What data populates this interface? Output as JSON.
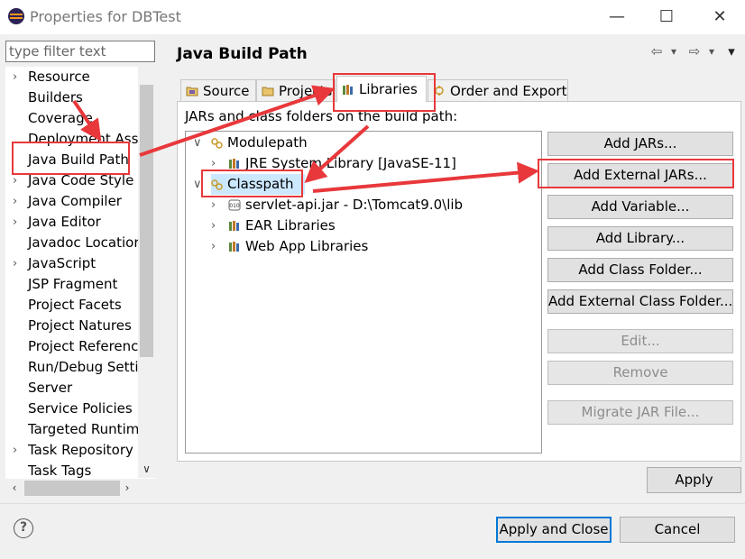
{
  "window": {
    "title": "Properties for DBTest",
    "minimize_glyph": "—",
    "maximize_glyph": "☐",
    "close_glyph": "✕"
  },
  "filter": {
    "placeholder": "type filter text"
  },
  "nav": {
    "items": [
      {
        "label": "Resource",
        "expandable": true
      },
      {
        "label": "Builders",
        "expandable": false
      },
      {
        "label": "Coverage",
        "expandable": false
      },
      {
        "label": "Deployment Ass",
        "expandable": false
      },
      {
        "label": "Java Build Path",
        "expandable": false,
        "selected": true
      },
      {
        "label": "Java Code Style",
        "expandable": true
      },
      {
        "label": "Java Compiler",
        "expandable": true
      },
      {
        "label": "Java Editor",
        "expandable": true
      },
      {
        "label": "Javadoc Locatior",
        "expandable": false
      },
      {
        "label": "JavaScript",
        "expandable": true
      },
      {
        "label": "JSP Fragment",
        "expandable": false
      },
      {
        "label": "Project Facets",
        "expandable": false
      },
      {
        "label": "Project Natures",
        "expandable": false
      },
      {
        "label": "Project Referenc",
        "expandable": false
      },
      {
        "label": "Run/Debug Setti",
        "expandable": false
      },
      {
        "label": "Server",
        "expandable": false
      },
      {
        "label": "Service Policies",
        "expandable": false
      },
      {
        "label": "Targeted Runtim",
        "expandable": false
      },
      {
        "label": "Task Repository",
        "expandable": true
      },
      {
        "label": "Task Tags",
        "expandable": false
      }
    ]
  },
  "header": {
    "title": "Java Build Path",
    "back_glyph": "⇦",
    "forward_glyph": "⇨",
    "dropdown_glyph": "▾",
    "menu_glyph": "▾"
  },
  "tabs": [
    {
      "label": "Source"
    },
    {
      "label": "Projects"
    },
    {
      "label": "Libraries",
      "active": true
    },
    {
      "label": "Order and Export"
    }
  ],
  "libraries": {
    "heading": "JARs and class folders on the build path:",
    "tree": [
      {
        "label": "Modulepath",
        "expanded": true
      },
      {
        "label": "JRE System Library [JavaSE-11]",
        "expanded": false
      },
      {
        "label": "Classpath",
        "expanded": true,
        "selected": true
      },
      {
        "label": "servlet-api.jar - D:\\Tomcat9.0\\lib",
        "expanded": false
      },
      {
        "label": "EAR Libraries",
        "expanded": false
      },
      {
        "label": "Web App Libraries",
        "expanded": false
      }
    ]
  },
  "buttons": {
    "add_jars": "Add JARs...",
    "add_external_jars": "Add External JARs...",
    "add_variable": "Add Variable...",
    "add_library": "Add Library...",
    "add_class_folder": "Add Class Folder...",
    "add_external_class_folder": "Add External Class Folder...",
    "edit": "Edit...",
    "remove": "Remove",
    "migrate_jar": "Migrate JAR File...",
    "apply": "Apply",
    "apply_and_close": "Apply and Close",
    "cancel": "Cancel"
  },
  "help": {
    "glyph": "?"
  },
  "colors": {
    "annotation_red": "#e8383b",
    "selection_blue": "#cce8ff",
    "default_button_border": "#0078d7"
  }
}
